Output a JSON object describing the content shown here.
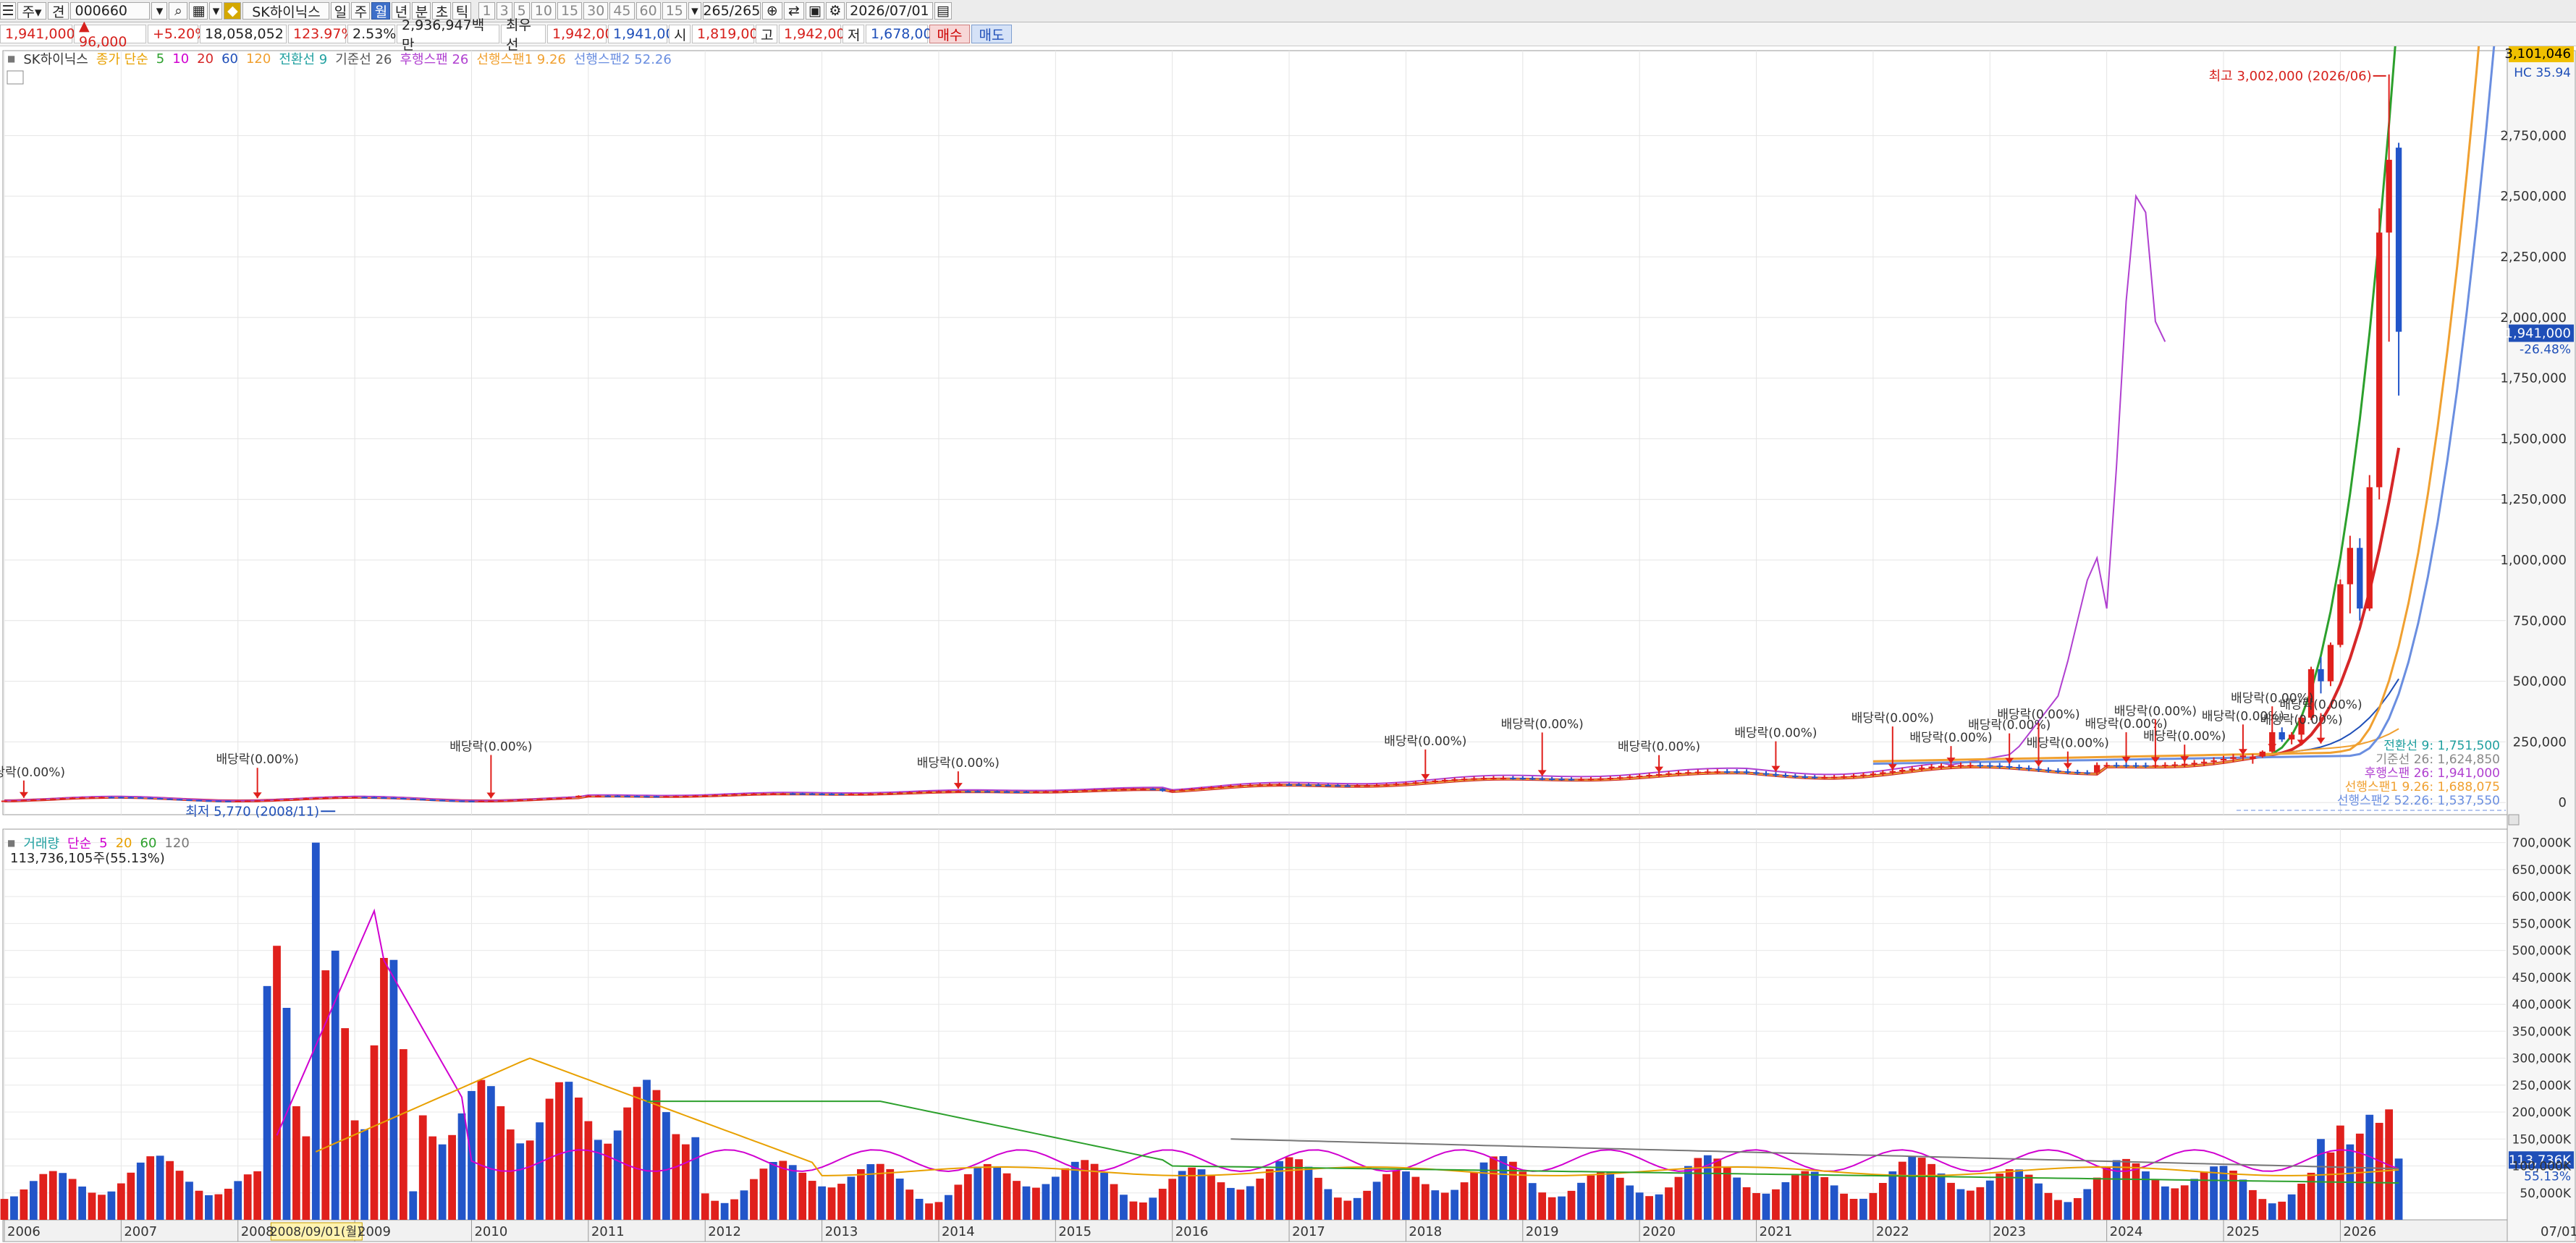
{
  "toolbar": {
    "chart_type_label": "견",
    "code": "000660",
    "stock_name": "SK하이닉스",
    "periods": [
      "일",
      "주",
      "월",
      "년",
      "분",
      "초",
      "틱"
    ],
    "selected_period": "월",
    "intervals": [
      "1",
      "3",
      "5",
      "10",
      "15",
      "30",
      "45",
      "60",
      "15"
    ],
    "range_count": "265/265",
    "date": "2026/07/01"
  },
  "quote": {
    "price": "1,941,000",
    "change": "▲ 96,000",
    "change_pct": "+5.20%",
    "volume": "18,058,052",
    "volume_ratio": "123.97%",
    "turnover": "2.53%",
    "amount": "2,936,947백만",
    "best_ask_label": "최우선",
    "best_ask": "1,942,000",
    "best_bid": "1,941,000",
    "open_label": "시",
    "open": "1,819,000",
    "high_label": "고",
    "high": "1,942,000",
    "low_label": "저",
    "low": "1,678,000",
    "buy_label": "매수",
    "sell_label": "매도"
  },
  "price_legend": [
    {
      "text": "SK하이닉스",
      "color": "#333333"
    },
    {
      "text": "종가 단순",
      "color": "#e8a000"
    },
    {
      "text": "5",
      "color": "#2ca02c"
    },
    {
      "text": "10",
      "color": "#d000d0"
    },
    {
      "text": "20",
      "color": "#d62728"
    },
    {
      "text": "60",
      "color": "#1f4fb8"
    },
    {
      "text": "120",
      "color": "#f0a030"
    },
    {
      "text": "전환선 9",
      "color": "#20a0a0"
    },
    {
      "text": "기준선 26",
      "color": "#555555"
    },
    {
      "text": "후행스팬 26",
      "color": "#b040d0"
    },
    {
      "text": "선행스팬1 9.26",
      "color": "#f0a030"
    },
    {
      "text": "선행스팬2 52.26",
      "color": "#6a8ee0"
    }
  ],
  "volume_legend": [
    {
      "text": "거래량",
      "color": "#20a0a0"
    },
    {
      "text": "단순",
      "color": "#d000d0"
    },
    {
      "text": "5",
      "color": "#d000d0"
    },
    {
      "text": "20",
      "color": "#e8a000"
    },
    {
      "text": "60",
      "color": "#2ca02c"
    },
    {
      "text": "120",
      "color": "#777777"
    }
  ],
  "volume_readout": "113,736,105주(55.13%)",
  "max_label": "최고 3,002,000 (2026/06)",
  "min_label": "최저 5,770 (2008/11)",
  "dividend_label": "배당락(0.00%)",
  "right_readouts": {
    "top_price": "3,101,046",
    "top_sub": "HC 35.94",
    "current_price": "1,941,000",
    "current_pct": "-26.48%",
    "vol_current": "113,736K",
    "vol_pct": "55.13%",
    "x_end": "07/01"
  },
  "line_labels": [
    {
      "text": "전환선 9: 1,751,500",
      "color": "#20a0a0"
    },
    {
      "text": "기준선 26: 1,624,850",
      "color": "#888888"
    },
    {
      "text": "후행스팬 26: 1,941,000",
      "color": "#b040d0"
    },
    {
      "text": "선행스팬1 9.26: 1,688,075",
      "color": "#f0a030"
    },
    {
      "text": "선행스팬2 52.26: 1,537,550",
      "color": "#6a8ee0"
    }
  ],
  "cursor_date": "2008/09/01(월)",
  "chart_data": {
    "type": "candlestick",
    "interval": "monthly",
    "xlim": [
      "2006-01",
      "2027-06"
    ],
    "price_ylim": [
      -50000,
      3100000
    ],
    "price_ticks": [
      0,
      250000,
      500000,
      750000,
      1000000,
      1250000,
      1500000,
      1750000,
      2000000,
      2250000,
      2500000,
      2750000
    ],
    "price_tick_labels": [
      "0",
      "250,000",
      "500,000",
      "750,000",
      "1,000,000",
      "1,250,000",
      "1,500,000",
      "1,750,000",
      "2,000,000",
      "2,250,000",
      "2,500,000",
      "2,750,000"
    ],
    "volume_ylim": [
      0,
      725000
    ],
    "volume_ticks": [
      50000,
      100000,
      150000,
      200000,
      250000,
      300000,
      350000,
      400000,
      450000,
      500000,
      550000,
      600000,
      650000,
      700000
    ],
    "volume_tick_labels": [
      "50,000K",
      "100,000K",
      "150,000K",
      "200,000K",
      "250,000K",
      "300,000K",
      "350,000K",
      "400,000K",
      "450,000K",
      "500,000K",
      "550,000K",
      "600,000K",
      "650,000K",
      "700,000K"
    ],
    "x_tick_labels": [
      "2006",
      "2007",
      "2008",
      "2009",
      "2010",
      "2011",
      "2012",
      "2013",
      "2014",
      "2015",
      "2016",
      "2017",
      "2018",
      "2019",
      "2020",
      "2021",
      "2022",
      "2023",
      "2024",
      "2025",
      "2026"
    ],
    "grid": true,
    "recent_candles": [
      {
        "date": "2025-04",
        "open": 180000,
        "high": 200000,
        "low": 160000,
        "close": 190000
      },
      {
        "date": "2025-05",
        "open": 190000,
        "high": 215000,
        "low": 185000,
        "close": 210000
      },
      {
        "date": "2025-06",
        "open": 210000,
        "high": 300000,
        "low": 205000,
        "close": 290000
      },
      {
        "date": "2025-07",
        "open": 290000,
        "high": 310000,
        "low": 250000,
        "close": 260000
      },
      {
        "date": "2025-08",
        "open": 260000,
        "high": 290000,
        "low": 240000,
        "close": 280000
      },
      {
        "date": "2025-09",
        "open": 280000,
        "high": 360000,
        "low": 270000,
        "close": 350000
      },
      {
        "date": "2025-10",
        "open": 350000,
        "high": 560000,
        "low": 340000,
        "close": 550000
      },
      {
        "date": "2025-11",
        "open": 550000,
        "high": 600000,
        "low": 450000,
        "close": 500000
      },
      {
        "date": "2025-12",
        "open": 500000,
        "high": 660000,
        "low": 480000,
        "close": 650000
      },
      {
        "date": "2026-01",
        "open": 650000,
        "high": 920000,
        "low": 640000,
        "close": 900000
      },
      {
        "date": "2026-02",
        "open": 900000,
        "high": 1100000,
        "low": 780000,
        "close": 1050000
      },
      {
        "date": "2026-03",
        "open": 1050000,
        "high": 1090000,
        "low": 750000,
        "close": 800000
      },
      {
        "date": "2026-04",
        "open": 800000,
        "high": 1350000,
        "low": 790000,
        "close": 1300000
      },
      {
        "date": "2026-05",
        "open": 1300000,
        "high": 2450000,
        "low": 1250000,
        "close": 2350000
      },
      {
        "date": "2026-06",
        "open": 2350000,
        "high": 3002000,
        "low": 1900000,
        "close": 2650000
      },
      {
        "date": "2026-07",
        "open": 2700000,
        "high": 2720000,
        "low": 1678000,
        "close": 1941000
      }
    ],
    "volume_recent": [
      {
        "date": "2025-11",
        "value": 150000
      },
      {
        "date": "2025-12",
        "value": 125000
      },
      {
        "date": "2026-01",
        "value": 175000
      },
      {
        "date": "2026-02",
        "value": 140000
      },
      {
        "date": "2026-03",
        "value": 160000
      },
      {
        "date": "2026-04",
        "value": 195000
      },
      {
        "date": "2026-05",
        "value": 180000
      },
      {
        "date": "2026-06",
        "value": 205000
      },
      {
        "date": "2026-07",
        "value": 113736
      }
    ],
    "volume_peak": {
      "date": "2008-09",
      "value": 700000
    },
    "max": {
      "date": "2026-06",
      "value": 3002000
    },
    "min": {
      "date": "2008-11",
      "value": 5770
    },
    "series": [
      {
        "name": "5",
        "color": "#2ca02c"
      },
      {
        "name": "10",
        "color": "#d000d0"
      },
      {
        "name": "20",
        "color": "#d62728"
      },
      {
        "name": "60",
        "color": "#1f4fb8"
      },
      {
        "name": "120",
        "color": "#f0a030"
      }
    ]
  }
}
